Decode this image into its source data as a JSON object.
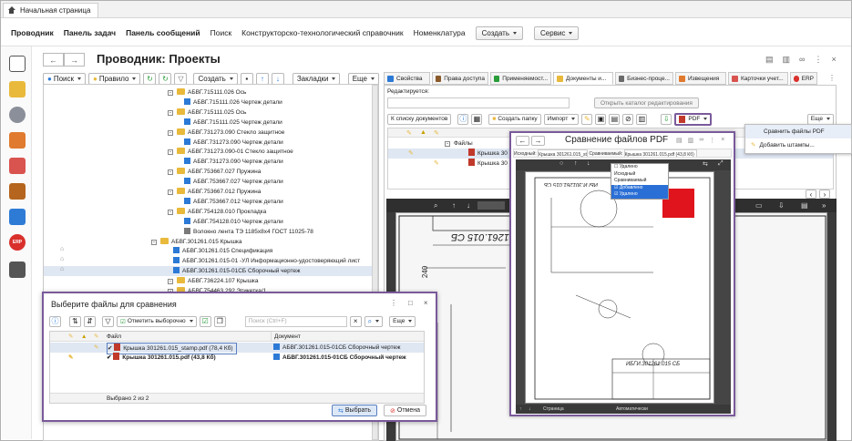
{
  "home_tab": {
    "label": "Начальная страница"
  },
  "main_menu": {
    "items": [
      "Проводник",
      "Панель задач",
      "Панель сообщений",
      "Поиск",
      "Конструкторско-технологический справочник",
      "Номенклатура"
    ],
    "create_label": "Создать",
    "service_label": "Сервис"
  },
  "page": {
    "title": "Проводник: Проекты"
  },
  "tree_toolbar": {
    "search": "Поиск",
    "rule": "Правило",
    "create": "Создать",
    "bookmarks": "Закладки",
    "more": "Еще"
  },
  "tree": {
    "rows": [
      {
        "text": "АБВГ.715111.026 Ось",
        "kind": "folder"
      },
      {
        "text": "АБВГ.715111.026 Чертеж детали",
        "kind": "doc"
      },
      {
        "text": "АБВГ.715111.025 Ось",
        "kind": "folder"
      },
      {
        "text": "АБВГ.715111.025 Чертеж детали",
        "kind": "doc"
      },
      {
        "text": "АБВГ.731273.090 Стекло защитное",
        "kind": "folder"
      },
      {
        "text": "АБВГ.731273.090 Чертеж детали",
        "kind": "doc"
      },
      {
        "text": "АБВГ.731273.090-01 Стекло защитное",
        "kind": "folder"
      },
      {
        "text": "АБВГ.731273.090 Чертеж детали",
        "kind": "doc"
      },
      {
        "text": "АБВГ.753667.027 Пружина",
        "kind": "folder"
      },
      {
        "text": "АБВГ.753667.027 Чертеж детали",
        "kind": "doc"
      },
      {
        "text": "АБВГ.753667.012 Пружина",
        "kind": "folder"
      },
      {
        "text": "АБВГ.753667.012 Чертеж детали",
        "kind": "doc"
      },
      {
        "text": "АБВГ.754128.010 Прокладка",
        "kind": "folder"
      },
      {
        "text": "АБВГ.754128.010 Чертеж детали",
        "kind": "doc"
      },
      {
        "text": "Волокно лента ТЭ 1185х8х4 ГОСТ 11025-78",
        "kind": "item"
      },
      {
        "text": "АБВГ.301261.015 Крышка",
        "kind": "folder"
      },
      {
        "text": "АБВГ.301261.015 Спецификация",
        "kind": "doc"
      },
      {
        "text": "АБВГ.301261.015-01 -УЛ Информационно-удостоверяющий лист",
        "kind": "doc"
      },
      {
        "text": "АБВГ.301261.015-01СБ Сборочный чертеж",
        "kind": "doc"
      },
      {
        "text": "АБВГ.736224.107 Крышка",
        "kind": "folder"
      },
      {
        "text": "АБВГ.754463.292 Этикетка/1",
        "kind": "folder"
      }
    ]
  },
  "right_tabs": [
    "Свойства",
    "Права доступа",
    "Применяемост...",
    "Документы и...",
    "Бизнес-проце...",
    "Извещения",
    "Карточки учет...",
    "ERP"
  ],
  "doc_panel": {
    "editing_label": "Редактируется:",
    "open_catalog": "Открыть каталог редактирования",
    "to_list": "К списку документов",
    "create_folder": "Создать папку",
    "import": "Импорт",
    "pdf": "PDF",
    "more": "Еще",
    "files_group": "Файлы",
    "file1": "Крышка 30",
    "file2": "Крышка 30"
  },
  "pdf_popup": {
    "compare": "Сравнить файлы PDF",
    "stamps": "Добавить штампы..."
  },
  "viewer": {
    "drawing_code": "ИБГИ.301261.015 СБ",
    "pages_label": "Страница"
  },
  "compare_window": {
    "title": "Сравнение файлов PDF",
    "source_label": "Исходный:",
    "source_file": "Крышка 301261.015_stamp.pdf",
    "compared_label": "Сравниваемый:",
    "compared_file": "Крышка 301261.015.pdf (43,8 Кб)",
    "legend": [
      "Удалено",
      "Исходный",
      "Сравниваемый",
      "Добавлено",
      "Удалено"
    ],
    "drawing_code": "ИБГИ.301261.015 СБ",
    "footer_page": "Страница",
    "footer_mode": "Автоматически"
  },
  "file_dialog": {
    "title": "Выберите файлы для сравнения",
    "mark_selected": "Отметить выборочно",
    "search_placeholder": "Поиск (Ctrl+F)",
    "more": "Еще",
    "col_file": "Файл",
    "col_doc": "Документ",
    "rows": [
      {
        "file": "Крышка 301261.015_stamp.pdf (78,4 Кб)",
        "doc": "АБВГ.301261.015-01СБ Сборочный чертеж",
        "bold": false
      },
      {
        "file": "Крышка 301261.015.pdf (43,8 Кб)",
        "doc": "АБВГ.301261.015-01СБ Сборочный чертеж",
        "bold": true
      }
    ],
    "selected_count": "Выбрано 2 из 2",
    "select": "Выбрать",
    "cancel": "Отмена"
  }
}
